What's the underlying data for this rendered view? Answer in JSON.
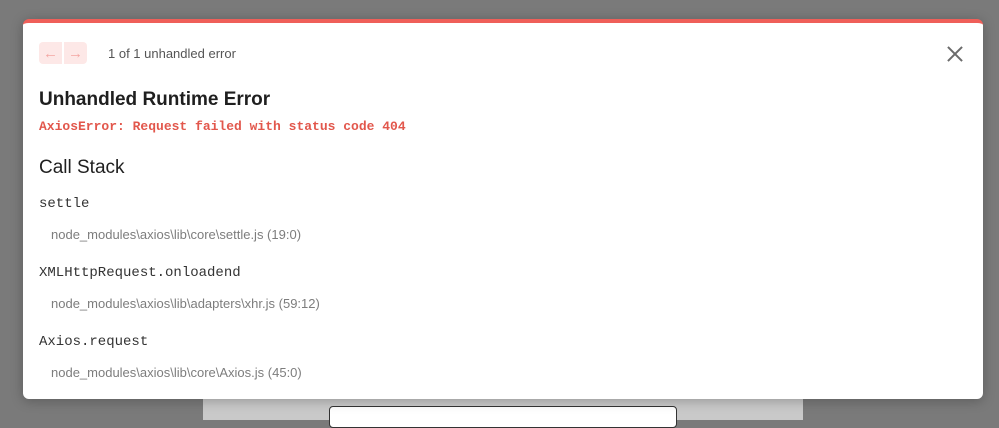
{
  "overlay": {
    "nav": {
      "prev_icon": "arrow-left",
      "next_icon": "arrow-right",
      "count_text": "1 of 1 unhandled error"
    },
    "close_icon": "close-x",
    "title": "Unhandled Runtime Error",
    "error_message": "AxiosError: Request failed with status code 404",
    "call_stack_title": "Call Stack",
    "frames": [
      {
        "function": "settle",
        "location": "node_modules\\axios\\lib\\core\\settle.js (19:0)"
      },
      {
        "function": "XMLHttpRequest.onloadend",
        "location": "node_modules\\axios\\lib\\adapters\\xhr.js (59:12)"
      },
      {
        "function": "Axios.request",
        "location": "node_modules\\axios\\lib\\core\\Axios.js (45:0)"
      }
    ]
  },
  "colors": {
    "accent": "#ef5f59",
    "error_text": "#e2574c",
    "backdrop": "#7a7a7a"
  }
}
